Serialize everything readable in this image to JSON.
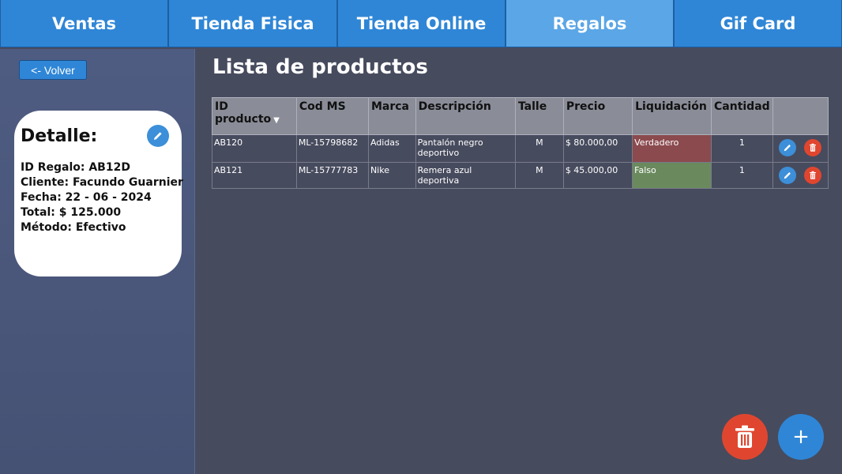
{
  "nav": {
    "tabs": [
      {
        "label": "Ventas"
      },
      {
        "label": "Tienda Fisica"
      },
      {
        "label": "Tienda Online"
      },
      {
        "label": "Regalos"
      },
      {
        "label": "Gif Card"
      }
    ],
    "active": "Regalos"
  },
  "sidebar": {
    "back_label": "<- Volver",
    "detail": {
      "title": "Detalle:",
      "lines": [
        "ID Regalo: AB12D",
        "Cliente: Facundo Guarnier",
        "Fecha: 22 - 06 - 2024",
        "Total: $ 125.000",
        "Método: Efectivo"
      ]
    }
  },
  "main": {
    "title": "Lista de productos",
    "columns": [
      "ID producto",
      "Cod MS",
      "Marca",
      "Descripción",
      "Talle",
      "Precio",
      "Liquidación",
      "Cantidad"
    ],
    "rows": [
      {
        "id": "AB120",
        "cod": "ML-15798682",
        "marca": "Adidas",
        "desc": "Pantalón negro deportivo",
        "talle": "M",
        "precio": "$ 80.000,00",
        "liq": "Verdadero",
        "cant": "1"
      },
      {
        "id": "AB121",
        "cod": "ML-15777783",
        "marca": "Nike",
        "desc": "Remera azul deportiva",
        "talle": "M",
        "precio": "$ 45.000,00",
        "liq": "Falso",
        "cant": "1"
      }
    ]
  },
  "fab": {
    "add_label": "+"
  },
  "colors": {
    "accent": "#2f86d6",
    "danger": "#e0462f",
    "liq_true": "#8b4a4e",
    "liq_false": "#6a8a5e"
  }
}
